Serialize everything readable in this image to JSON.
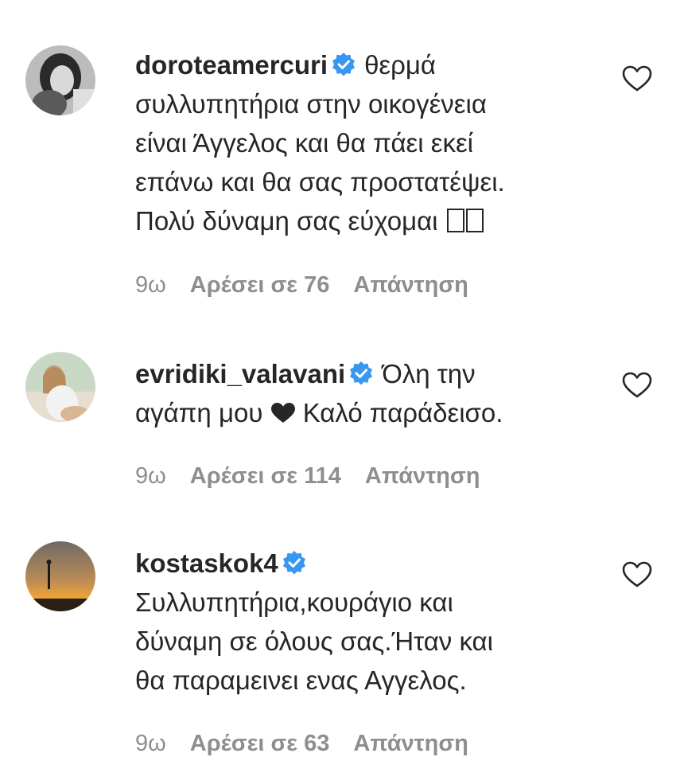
{
  "comments": [
    {
      "username": "doroteamercuri",
      "verified": true,
      "text_lines": [
        "θερμά",
        "συλλυπητήρια στην οικογένεια",
        "είναι Άγγελος και θα πάει εκεί",
        "επάνω και θα σας προστατέψει.",
        "Πολύ δύναμη σας εύχομαι"
      ],
      "time": "9ω",
      "likes": "Αρέσει σε 76",
      "reply": "Απάντηση"
    },
    {
      "username": "evridiki_valavani",
      "verified": true,
      "text_lines": [
        "Όλη την",
        "αγάπη μου",
        "Καλό παράδεισο."
      ],
      "time": "9ω",
      "likes": "Αρέσει σε 114",
      "reply": "Απάντηση"
    },
    {
      "username": "kostaskok4",
      "verified": true,
      "text_lines": [
        "Συλλυπητήρια,κουράγιο και",
        "δύναμη σε όλους σας.Ήταν και",
        "θα παραμεινει ενας Αγγελος."
      ],
      "time": "9ω",
      "likes": "Αρέσει σε 63",
      "reply": "Απάντηση"
    }
  ],
  "colors": {
    "text": "#262626",
    "meta": "#8e8e8e",
    "verified": "#3897f0"
  },
  "icons": {
    "verified": "verified-badge-icon",
    "like": "heart-outline-icon",
    "emoji_heart": "black-heart-icon"
  }
}
